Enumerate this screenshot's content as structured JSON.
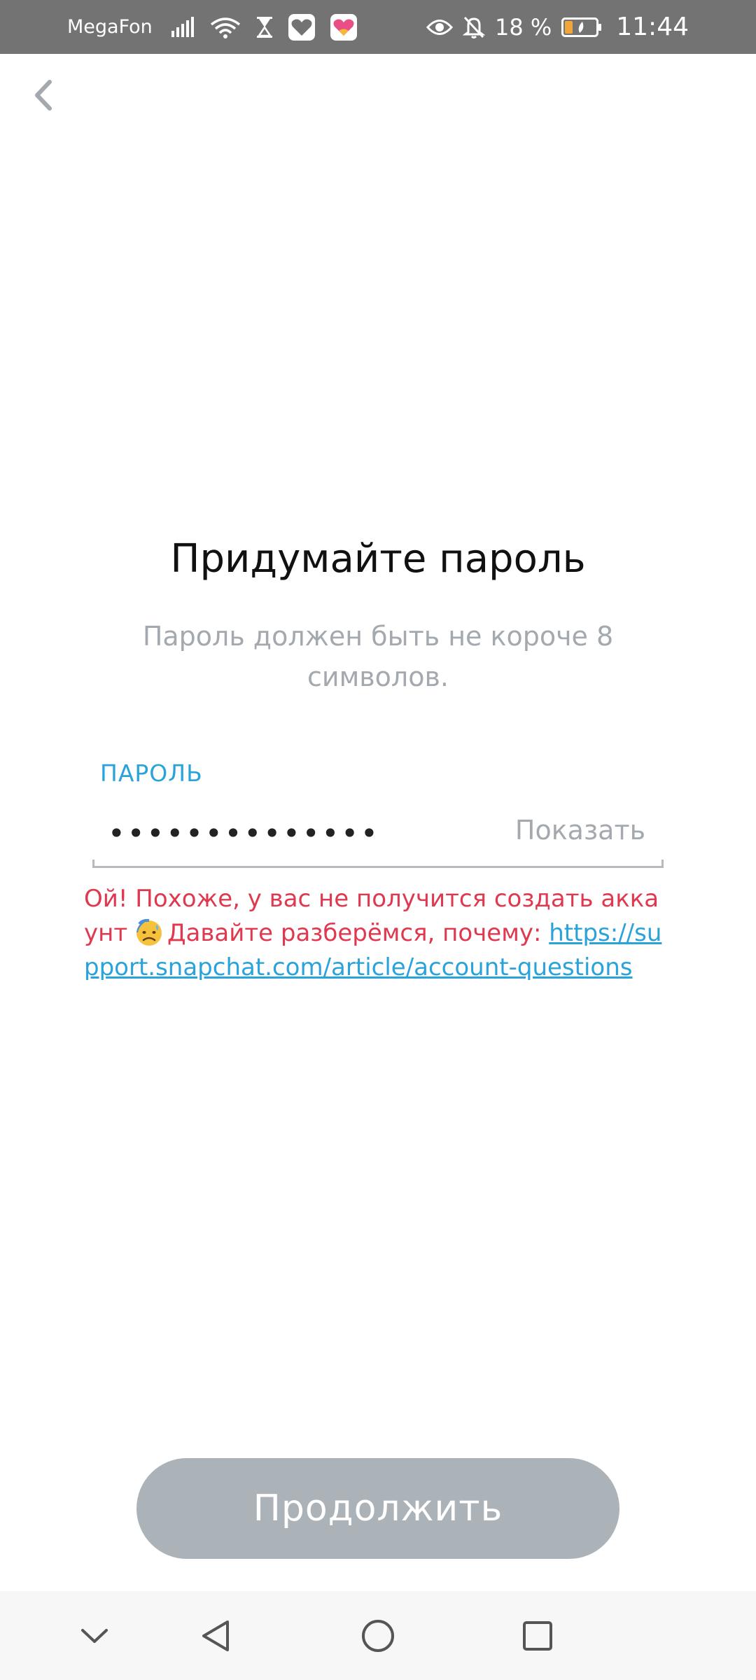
{
  "status_bar": {
    "carrier": "MegaFon",
    "battery_percent": "18 %",
    "time": "11:44",
    "icons_left": [
      "signal-icon",
      "wifi-icon",
      "hourglass-icon",
      "heart-app-icon",
      "likee-app-icon"
    ],
    "icons_right": [
      "eye-icon",
      "bell-off-icon",
      "battery-icon"
    ]
  },
  "header": {
    "back_icon": "chevron-left-icon"
  },
  "main": {
    "title": "Придумайте пароль",
    "subtitle": "Пароль должен быть не короче 8 символов.",
    "password_field": {
      "label": "ПАРОЛЬ",
      "value": "••••••••••••••",
      "show_label": "Показать"
    },
    "error": {
      "line1": "Ой! Похоже, у вас не получится создать аккаунт",
      "emoji_icon": "sweat-face-emoji-icon",
      "line2_prefix": "Давайте разберёмся, почему: ",
      "link": "https://support.snapchat.com/article/account-questions"
    },
    "continue_label": "Продолжить"
  },
  "nav_bar": {
    "items": [
      "chevron-down-icon",
      "back-triangle-icon",
      "home-circle-icon",
      "recents-square-icon"
    ]
  },
  "colors": {
    "accent_blue": "#2aa3da",
    "error_red": "#e0384f",
    "button_disabled": "#abb3b9",
    "status_bar_bg": "#737373"
  }
}
